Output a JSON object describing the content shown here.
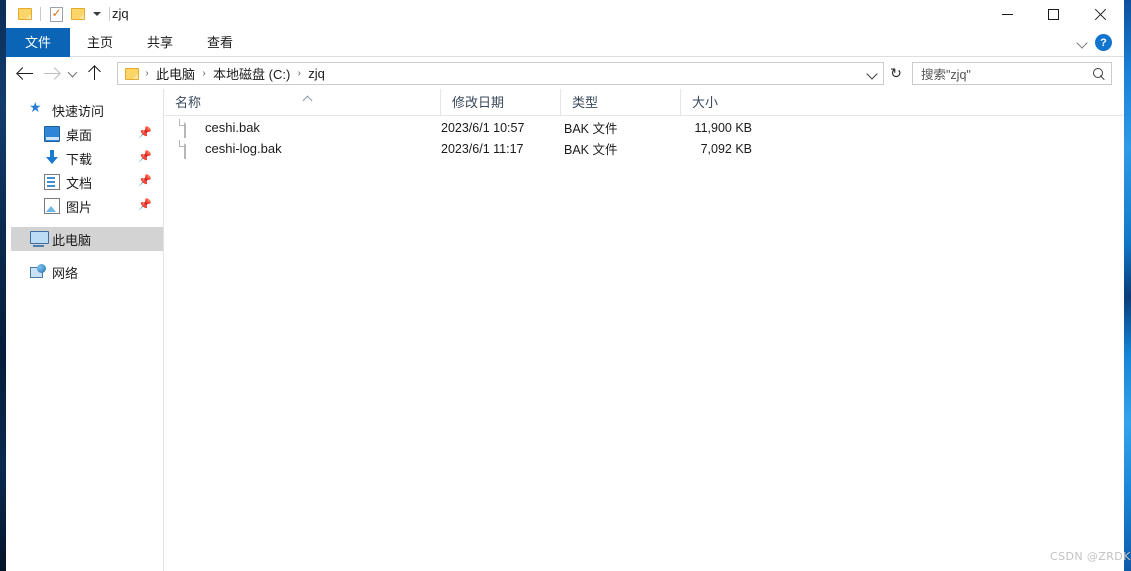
{
  "window": {
    "title": "zjq",
    "controls": {
      "minimize": "—",
      "maximize": "□",
      "close": "✕"
    },
    "quick_access_toolbar": {
      "folder_icon": "folder-icon",
      "properties_icon": "properties-checkbox-icon",
      "new_folder_icon": "new-folder-icon",
      "customize_caret": "caret-down-icon"
    }
  },
  "ribbon": {
    "tabs": [
      {
        "label": "文件",
        "active": true
      },
      {
        "label": "主页",
        "active": false
      },
      {
        "label": "共享",
        "active": false
      },
      {
        "label": "查看",
        "active": false
      }
    ],
    "collapse_icon": "chevron-down-icon",
    "help_label": "?",
    "active_tab_color": "#0b64b5"
  },
  "navigation": {
    "back_icon": "arrow-left-icon",
    "forward_icon": "arrow-right-icon",
    "recent_icon": "chevron-down-icon",
    "up_icon": "arrow-up-icon",
    "refresh_icon": "↻",
    "address": {
      "folder_icon": "folder-icon",
      "crumbs": [
        "此电脑",
        "本地磁盘 (C:)",
        "zjq"
      ],
      "separator": "›",
      "dropdown_icon": "chevron-down-icon"
    },
    "search": {
      "placeholder": "搜索\"zjq\"",
      "icon": "search-icon"
    }
  },
  "sidebar": {
    "items": [
      {
        "label": "快速访问",
        "icon": "star-quick-access-icon",
        "indent": false,
        "pinned": false,
        "selected": false
      },
      {
        "label": "桌面",
        "icon": "desktop-icon",
        "indent": true,
        "pinned": true,
        "selected": false
      },
      {
        "label": "下载",
        "icon": "download-icon",
        "indent": true,
        "pinned": true,
        "selected": false
      },
      {
        "label": "文档",
        "icon": "documents-icon",
        "indent": true,
        "pinned": true,
        "selected": false
      },
      {
        "label": "图片",
        "icon": "pictures-icon",
        "indent": true,
        "pinned": true,
        "selected": false
      },
      {
        "label": "此电脑",
        "icon": "this-pc-icon",
        "indent": false,
        "pinned": false,
        "selected": true
      },
      {
        "label": "网络",
        "icon": "network-icon",
        "indent": false,
        "pinned": false,
        "selected": false
      }
    ],
    "pin_glyph": "📌",
    "selection_color": "#d3d3d3"
  },
  "file_list": {
    "columns": [
      {
        "label": "名称",
        "sorted": "asc"
      },
      {
        "label": "修改日期",
        "sorted": ""
      },
      {
        "label": "类型",
        "sorted": ""
      },
      {
        "label": "大小",
        "sorted": ""
      }
    ],
    "rows": [
      {
        "name": "ceshi.bak",
        "date": "2023/6/1 10:57",
        "type": "BAK 文件",
        "size": "11,900 KB",
        "icon": "file-icon"
      },
      {
        "name": "ceshi-log.bak",
        "date": "2023/6/1 11:17",
        "type": "BAK 文件",
        "size": "7,092 KB",
        "icon": "file-icon"
      }
    ]
  },
  "watermark": {
    "text": "CSDN @ZRDK"
  }
}
